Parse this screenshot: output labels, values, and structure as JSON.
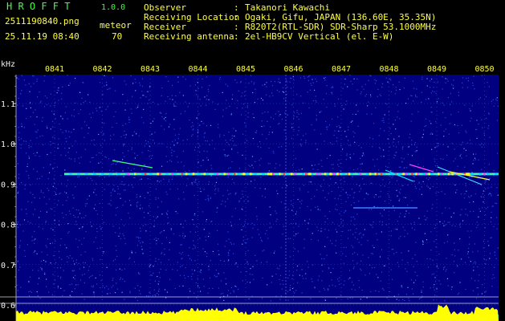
{
  "header": {
    "app_title": "H R O F F T",
    "app_version": "1.0.0",
    "file_name": "2511190840.png",
    "detection_type": "meteor",
    "datetime": "25.11.19 08:40",
    "count": "70",
    "info": [
      {
        "label": "Observer",
        "sep": ":",
        "value": "Takanori Kawachi"
      },
      {
        "label": "Receiving Location",
        "sep": ":",
        "value": "Ogaki, Gifu, JAPAN (136.60E, 35.35N)"
      },
      {
        "label": "Receiver",
        "sep": ":",
        "value": "R820T2(RTL-SDR) SDR-Sharp 53.1000MHz"
      },
      {
        "label": "Receiving antenna",
        "sep": ":",
        "value": "2el-HB9CV Vertical (el. E-W)"
      }
    ]
  },
  "spectrogram": {
    "unit_label": "kHz",
    "time_labels": [
      "0841",
      "0842",
      "0843",
      "0844",
      "0845",
      "0846",
      "0847",
      "0848",
      "0849",
      "0850"
    ],
    "freq_labels": [
      "1.1",
      "1.0",
      "0.9",
      "0.8",
      "0.7",
      "0.6"
    ],
    "freq_range": [
      0.58,
      1.18
    ],
    "carrier_freq": 0.925,
    "colors": {
      "background": "#000080",
      "noise": "#3a5cff",
      "text_green": "#40ff40",
      "text_yellow": "#ffff40",
      "bottom_bar": "#ffff00",
      "bottom_base": "#00c0ff"
    }
  }
}
